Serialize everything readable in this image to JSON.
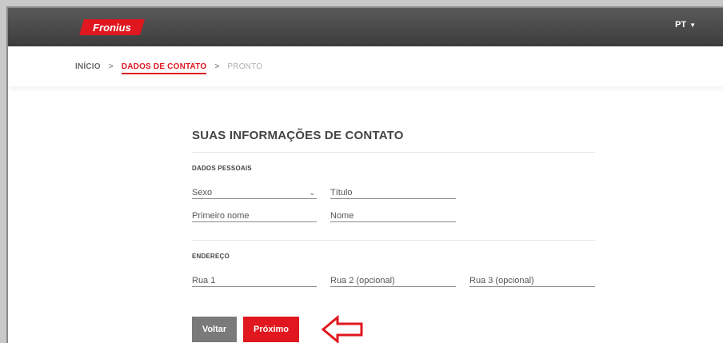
{
  "header": {
    "brand": "Fronius",
    "language": "PT"
  },
  "breadcrumb": {
    "items": [
      {
        "label": "INÍCIO"
      },
      {
        "label": "DADOS DE CONTATO"
      },
      {
        "label": "PRONTO"
      }
    ],
    "separator": ">"
  },
  "form": {
    "title": "SUAS INFORMAÇÕES DE CONTATO",
    "personal": {
      "heading": "DADOS PESSOAIS",
      "sexo": "Sexo",
      "titulo": "Título",
      "primeiro_nome": "Primeiro nome",
      "nome": "Nome"
    },
    "address": {
      "heading": "ENDEREÇO",
      "rua1": "Rua 1",
      "rua2": "Rua 2 (opcional)",
      "rua3": "Rua 3 (opcional)"
    },
    "buttons": {
      "back": "Voltar",
      "next": "Próximo"
    }
  },
  "colors": {
    "accent": "#e0171f",
    "header_bg": "#4a4a4a",
    "back_button": "#7a7a7a"
  },
  "icons": {
    "language_caret": "caret-down-icon",
    "sexo_select": "chevron-down-icon",
    "annotation": "left-arrow-icon"
  }
}
